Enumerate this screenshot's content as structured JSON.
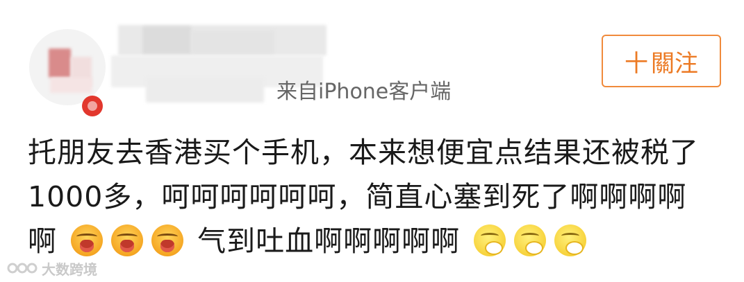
{
  "post": {
    "source": "来自iPhone客户端",
    "follow_button": {
      "plus": "十",
      "label": "關注"
    },
    "content": {
      "line1": "托朋友去香港买个手机，本来想便宜点结果还被税了",
      "line2": "1000多，呵呵呵呵呵呵，简直心塞到死了啊啊啊啊",
      "line3_prefix": "啊",
      "line3_mid": "气到吐血啊啊啊啊啊",
      "emoji_set_1": [
        "crying-face-icon",
        "crying-face-icon",
        "crying-face-icon"
      ],
      "emoji_set_2": [
        "vomit-face-icon",
        "vomit-face-icon",
        "vomit-face-icon"
      ]
    }
  },
  "watermark": {
    "text": "大数跨境"
  },
  "colors": {
    "accent": "#f08a3b",
    "text": "#1a1a1a",
    "meta": "#666666"
  }
}
